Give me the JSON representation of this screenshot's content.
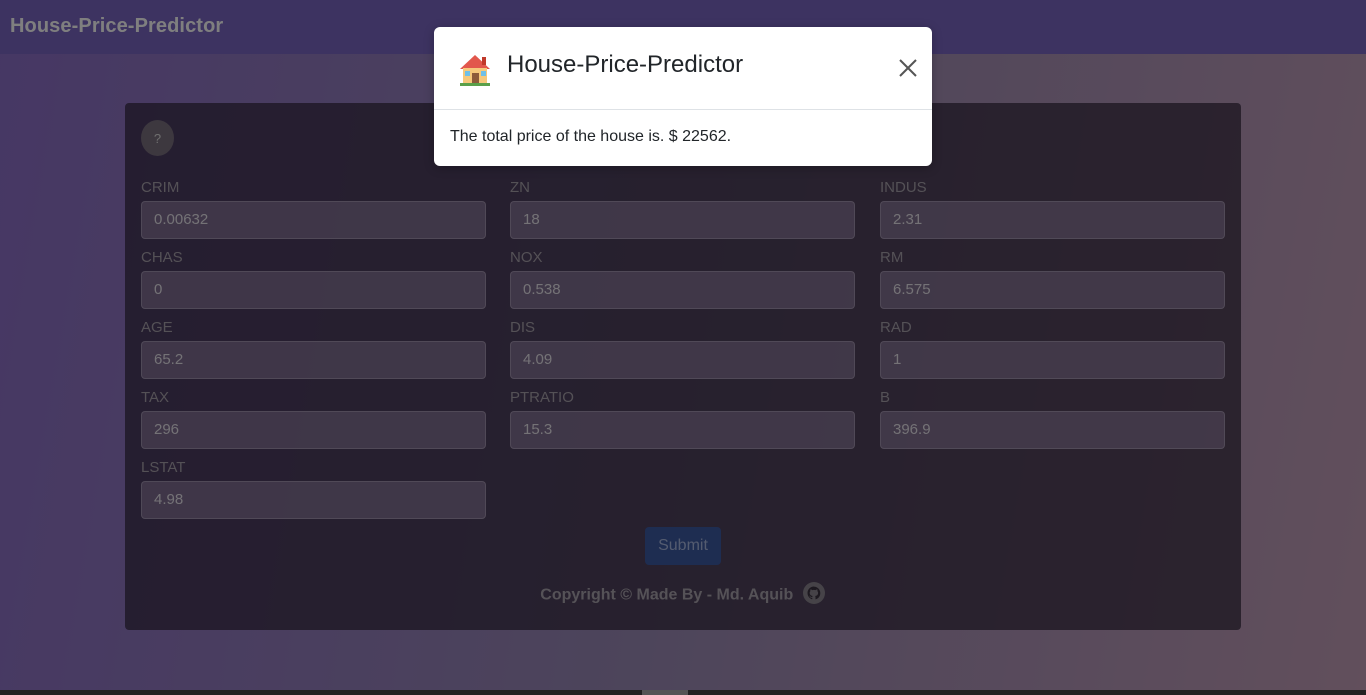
{
  "navbar": {
    "brand": "House-Price-Predictor"
  },
  "form": {
    "help_label": "?",
    "fields": [
      {
        "label": "CRIM",
        "value": "0.00632"
      },
      {
        "label": "ZN",
        "value": "18"
      },
      {
        "label": "INDUS",
        "value": "2.31"
      },
      {
        "label": "CHAS",
        "value": "0"
      },
      {
        "label": "NOX",
        "value": "0.538"
      },
      {
        "label": "RM",
        "value": "6.575"
      },
      {
        "label": "AGE",
        "value": "65.2"
      },
      {
        "label": "DIS",
        "value": "4.09"
      },
      {
        "label": "RAD",
        "value": "1"
      },
      {
        "label": "TAX",
        "value": "296"
      },
      {
        "label": "PTRATIO",
        "value": "15.3"
      },
      {
        "label": "B",
        "value": "396.9"
      },
      {
        "label": "LSTAT",
        "value": "4.98"
      }
    ],
    "submit_label": "Submit"
  },
  "footer": {
    "text": "Copyright © Made By - Md. Aquib",
    "icon": "github-icon"
  },
  "modal": {
    "title": "House-Price-Predictor",
    "icon": "house-icon",
    "body": "The total price of the house is. $ 22562.",
    "close_icon": "close-icon"
  }
}
